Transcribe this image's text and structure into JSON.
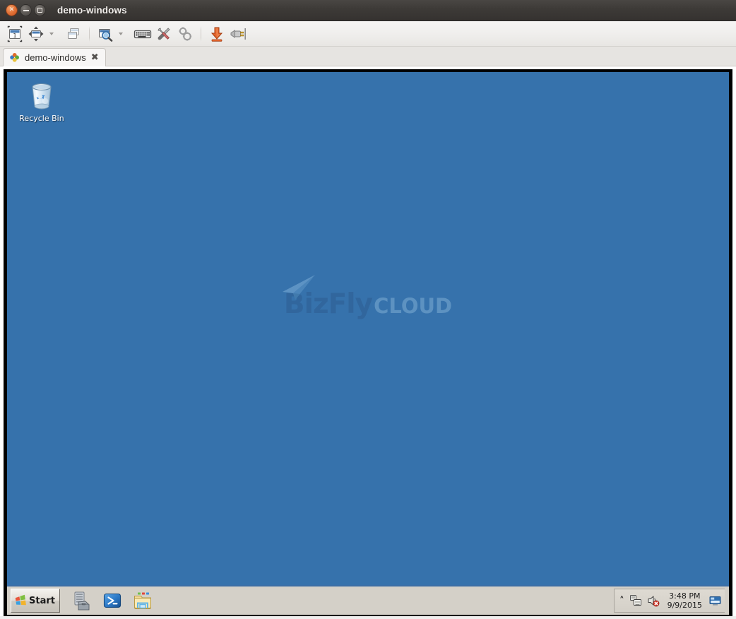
{
  "window": {
    "title": "demo-windows",
    "buttons": {
      "close": "close-button",
      "minimize": "minimize-button",
      "maximize": "maximize-button"
    }
  },
  "toolbar": {
    "items": [
      {
        "name": "scaled-window-icon",
        "tooltip": "Resize the window to fit in remote resolution"
      },
      {
        "name": "fullscreen-icon",
        "tooltip": "Toggle fullscreen mode"
      },
      {
        "name": "fullscreen-dropdown",
        "tooltip": "Fullscreen options"
      },
      {
        "name": "multi-monitor-icon",
        "tooltip": "Multi monitor"
      },
      {
        "name": "scale-zoom-icon",
        "tooltip": "Toggle dynamic resolution update"
      },
      {
        "name": "scale-dropdown",
        "tooltip": "Scaler options"
      },
      {
        "name": "keyboard-grab-icon",
        "tooltip": "Grab keyboard"
      },
      {
        "name": "preferences-icon",
        "tooltip": "Preferences"
      },
      {
        "name": "tools-icon",
        "tooltip": "Tools"
      },
      {
        "name": "minimize-window-icon",
        "tooltip": "Minimize window"
      },
      {
        "name": "disconnect-icon",
        "tooltip": "Disconnect"
      }
    ]
  },
  "tab": {
    "label": "demo-windows",
    "close_glyph": "✖",
    "icon": "remmina-tab-icon"
  },
  "desktop": {
    "background_color": "#3672ac",
    "icons": [
      {
        "name": "recycle-bin",
        "label": "Recycle Bin"
      }
    ],
    "watermark": {
      "brand_primary": "BizFly",
      "brand_secondary": "CLOUD",
      "primary_color": "#2f5f94",
      "secondary_color": "#76a6cf"
    }
  },
  "taskbar": {
    "start_label": "Start",
    "quick_launch": [
      {
        "name": "server-manager-icon",
        "label": "Server Manager"
      },
      {
        "name": "powershell-icon",
        "label": "Windows PowerShell"
      },
      {
        "name": "file-explorer-icon",
        "label": "Windows Explorer"
      }
    ],
    "tray": {
      "overflow_glyph": "˄",
      "icons": [
        {
          "name": "network-icon",
          "label": "Network"
        },
        {
          "name": "volume-muted-icon",
          "label": "Volume muted"
        }
      ],
      "time": "3:48 PM",
      "date": "9/9/2015",
      "show_desktop": "show-desktop-button"
    }
  }
}
